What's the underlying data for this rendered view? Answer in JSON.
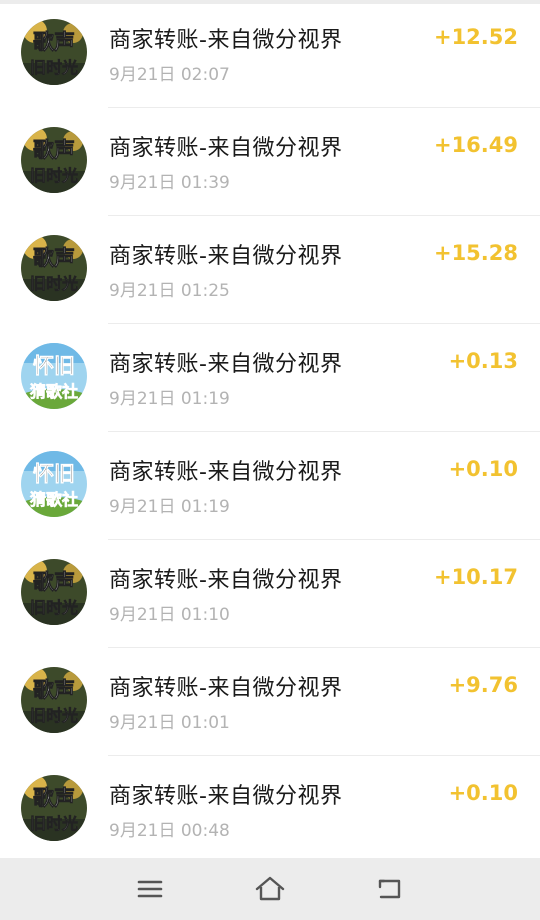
{
  "items": [
    {
      "avatar": "gesheng",
      "avatar_text": [
        "歌声",
        "旧时光"
      ],
      "title": "商家转账-来自微分视界",
      "time": "9月21日 02:07",
      "amount": "+12.52"
    },
    {
      "avatar": "gesheng",
      "avatar_text": [
        "歌声",
        "旧时光"
      ],
      "title": "商家转账-来自微分视界",
      "time": "9月21日 01:39",
      "amount": "+16.49"
    },
    {
      "avatar": "gesheng",
      "avatar_text": [
        "歌声",
        "旧时光"
      ],
      "title": "商家转账-来自微分视界",
      "time": "9月21日 01:25",
      "amount": "+15.28"
    },
    {
      "avatar": "huaijiu",
      "avatar_text": [
        "怀旧",
        "猜歌社"
      ],
      "title": "商家转账-来自微分视界",
      "time": "9月21日 01:19",
      "amount": "+0.13"
    },
    {
      "avatar": "huaijiu",
      "avatar_text": [
        "怀旧",
        "猜歌社"
      ],
      "title": "商家转账-来自微分视界",
      "time": "9月21日 01:19",
      "amount": "+0.10"
    },
    {
      "avatar": "gesheng",
      "avatar_text": [
        "歌声",
        "旧时光"
      ],
      "title": "商家转账-来自微分视界",
      "time": "9月21日 01:10",
      "amount": "+10.17"
    },
    {
      "avatar": "gesheng",
      "avatar_text": [
        "歌声",
        "旧时光"
      ],
      "title": "商家转账-来自微分视界",
      "time": "9月21日 01:01",
      "amount": "+9.76"
    },
    {
      "avatar": "gesheng",
      "avatar_text": [
        "歌声",
        "旧时光"
      ],
      "title": "商家转账-来自微分视界",
      "time": "9月21日 00:48",
      "amount": "+0.10"
    }
  ],
  "colors": {
    "amount": "#f2c230",
    "title": "#1a1a1a",
    "time": "#b3b3b3",
    "navbar": "#ececec"
  },
  "navbar": {
    "buttons": [
      "menu-icon",
      "home-icon",
      "back-icon"
    ]
  }
}
